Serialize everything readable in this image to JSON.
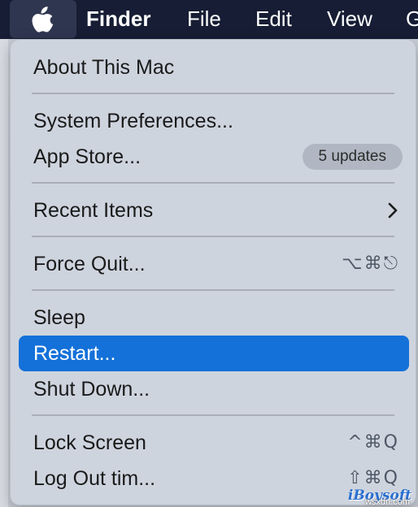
{
  "menubar": {
    "apple_icon": "apple-logo-icon",
    "items": [
      "Finder",
      "File",
      "Edit",
      "View",
      "G"
    ]
  },
  "apple_menu": {
    "items": [
      {
        "label": "About This Mac"
      },
      {
        "label": "System Preferences..."
      },
      {
        "label": "App Store...",
        "badge": "5 updates"
      },
      {
        "label": "Recent Items",
        "submenu_icon": "chevron-right-icon"
      },
      {
        "label": "Force Quit...",
        "shortcut": "⌥⌘⎋"
      },
      {
        "label": "Sleep"
      },
      {
        "label": "Restart...",
        "selected": true
      },
      {
        "label": "Shut Down..."
      },
      {
        "label": "Lock Screen",
        "shortcut": "^⌘Q"
      },
      {
        "label": "Log Out tim...",
        "shortcut": "⇧⌘Q"
      }
    ]
  },
  "watermark": {
    "text": "iBoysoft",
    "sub": "wsxdn.com"
  },
  "colors": {
    "menubar_bg": "#161d34",
    "selection": "#1471d9",
    "menu_bg": "#ced4de"
  }
}
